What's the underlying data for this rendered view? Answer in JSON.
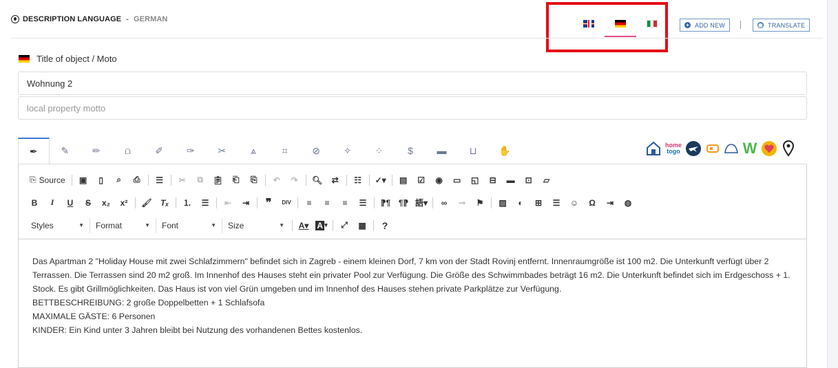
{
  "header": {
    "title": "DESCRIPTION LANGUAGE",
    "separator": "-",
    "language": "GERMAN"
  },
  "language_tabs": [
    {
      "flag": "uk",
      "name": "English"
    },
    {
      "flag": "de",
      "name": "German",
      "active": true
    },
    {
      "flag": "it",
      "name": "Italian"
    }
  ],
  "buttons": {
    "add_new": "ADD NEW",
    "translate": "TRANSLATE"
  },
  "title_field": {
    "label": "Title of object / Moto",
    "value": "Wohnung 2",
    "motto_placeholder": "local property motto"
  },
  "editor_tabs": [
    "pen-nib-icon",
    "brush-icon",
    "pencil-icon",
    "heel-icon",
    "pencil-alt-icon",
    "marker-icon",
    "tools-icon",
    "compass-icon",
    "crop-icon",
    "crossed-pen-icon",
    "magic-wand-icon",
    "network-icon",
    "dollar-icon",
    "bed-icon",
    "bath-icon",
    "hand-icon"
  ],
  "portals": [
    "home-portal",
    "hometogo",
    "airplane-portal",
    "tag-portal",
    "wave-portal",
    "w-portal",
    "heart-portal",
    "map-pin-portal"
  ],
  "toolbar": {
    "source_label": "Source",
    "styles_label": "Styles",
    "format_label": "Format",
    "font_label": "Font",
    "size_label": "Size"
  },
  "content": {
    "paragraph": "Das Apartman 2 \"Holiday House mit zwei Schlafzimmern\" befindet sich in Zagreb - einem kleinen Dorf, 7 km von der Stadt Rovinj entfernt. Innenraumgröße ist 100 m2. Die Unterkunft verfügt über 2 Terrassen. Die Terrassen sind 20 m2 groß. Im Innenhof des Hauses steht ein privater Pool zur Verfügung. Die Größe des Schwimmbades beträgt 16 m2. Die Unterkunft befindet sich im Erdgeschoss + 1. Stock. Es gibt Grillmöglichkeiten. Das Haus ist von viel Grün umgeben und im Innenhof des Hauses stehen private Parkplätze zur Verfügung.",
    "line1": "BETTBESCHREIBUNG: 2 große Doppelbetten + 1 Schlafsofa",
    "line2": "MAXIMALE GÄSTE: 6 Personen",
    "line3": "KINDER: Ein Kind unter 3 Jahren bleibt bei Nutzung des vorhandenen Bettes kostenlos."
  },
  "colors": {
    "accent": "#3466a4",
    "active_tab": "#e14b8a",
    "highlight": "#e50914"
  }
}
